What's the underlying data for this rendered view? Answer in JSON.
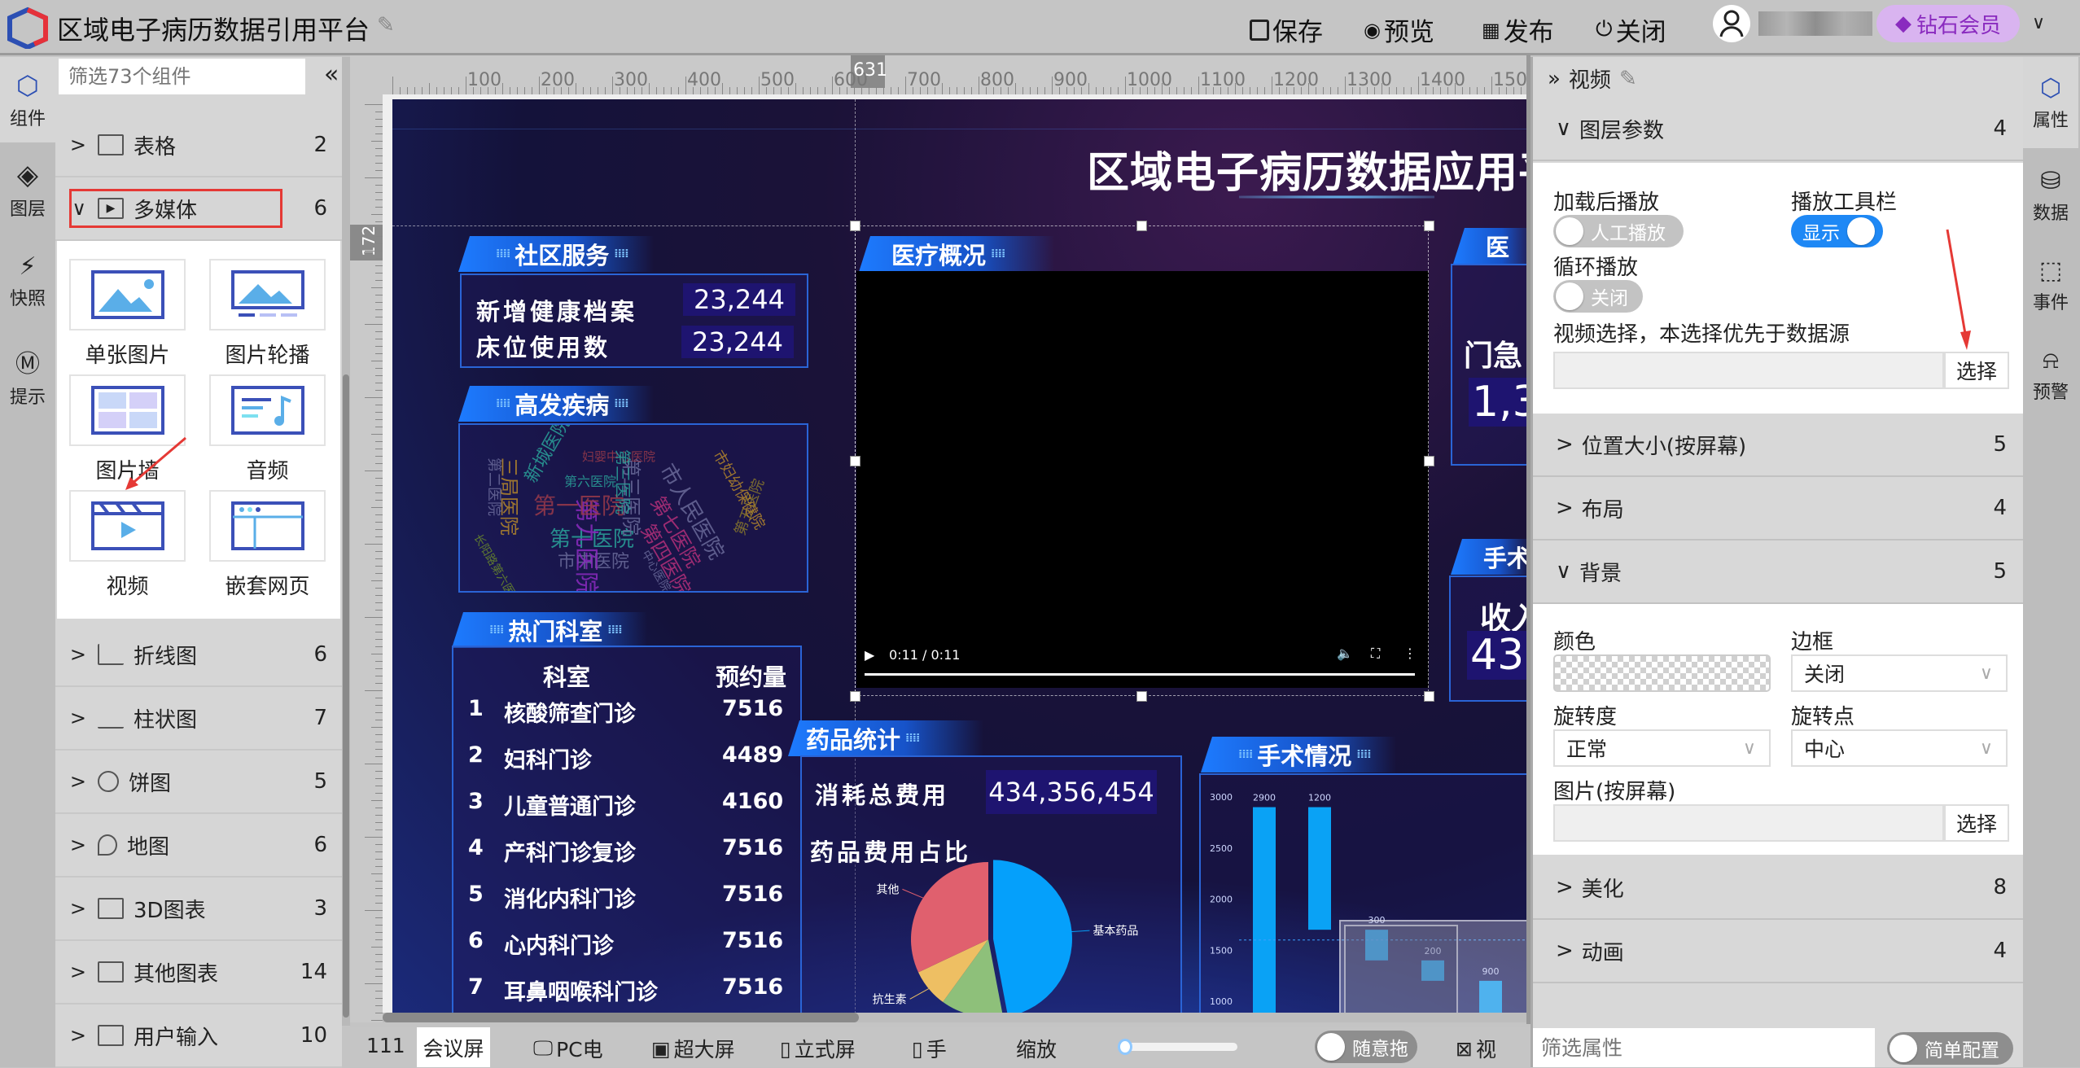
{
  "app": {
    "title": "区域电子病历数据引用平台",
    "user_name": "",
    "vip": "钻石会员"
  },
  "toolbar": {
    "save": "保存",
    "preview": "预览",
    "publish": "发布",
    "close": "关闭"
  },
  "left_rail": [
    {
      "label": "组件",
      "icon": "cube-icon"
    },
    {
      "label": "图层",
      "icon": "layers-icon"
    },
    {
      "label": "快照",
      "icon": "camera-icon"
    },
    {
      "label": "提示",
      "icon": "bulb-icon"
    }
  ],
  "components": {
    "search_placeholder": "筛选73个组件",
    "categories": [
      {
        "label": "表格",
        "count": "2",
        "expanded": false
      },
      {
        "label": "多媒体",
        "count": "6",
        "expanded": true
      },
      {
        "label": "折线图",
        "count": "6"
      },
      {
        "label": "柱状图",
        "count": "7"
      },
      {
        "label": "饼图",
        "count": "5"
      },
      {
        "label": "地图",
        "count": "6"
      },
      {
        "label": "3D图表",
        "count": "3"
      },
      {
        "label": "其他图表",
        "count": "14"
      },
      {
        "label": "用户输入",
        "count": "10"
      }
    ],
    "media_items": [
      {
        "label": "单张图片"
      },
      {
        "label": "图片轮播"
      },
      {
        "label": "图片墙"
      },
      {
        "label": "音频"
      },
      {
        "label": "视频"
      },
      {
        "label": "嵌套网页"
      }
    ]
  },
  "ruler": {
    "labels": [
      "100",
      "200",
      "300",
      "400",
      "500",
      "600",
      "700",
      "800",
      "900",
      "1000",
      "1100",
      "1200",
      "1300",
      "1400",
      "1500"
    ],
    "marker_x": "631",
    "marker_y": "172"
  },
  "dashboard": {
    "title": "区域电子病历数据应用平",
    "community": {
      "header": "社区服务",
      "rows": [
        {
          "label": "新增健康档案",
          "value": "23,244"
        },
        {
          "label": "床位使用数",
          "value": "23,244"
        }
      ]
    },
    "diseases": {
      "header": "高发疾病",
      "words": [
        "第十医院",
        "市中医院",
        "第九医院",
        "第三医院",
        "第一医院",
        "三局医院",
        "第二医院",
        "新城医院",
        "第六医院",
        "妇婴中心医院",
        "市人民医院",
        "第七医院",
        "第四医院",
        "第五医院",
        "市妇幼保健院",
        "中心医院",
        "第三医院",
        "长阳路第六医院"
      ]
    },
    "departments": {
      "header": "热门科室",
      "columns": [
        "科室",
        "预约量"
      ],
      "rows": [
        {
          "rank": "1",
          "name": "核酸筛查门诊",
          "value": "7516"
        },
        {
          "rank": "2",
          "name": "妇科门诊",
          "value": "4489"
        },
        {
          "rank": "3",
          "name": "儿童普通门诊",
          "value": "4160"
        },
        {
          "rank": "4",
          "name": "产科门诊复诊",
          "value": "7516"
        },
        {
          "rank": "5",
          "name": "消化内科门诊",
          "value": "7516"
        },
        {
          "rank": "6",
          "name": "心内科门诊",
          "value": "7516"
        },
        {
          "rank": "7",
          "name": "耳鼻咽喉科门诊",
          "value": "7516"
        }
      ]
    },
    "medical": {
      "header": "医疗概况",
      "video_time": "0:11 / 0:11"
    },
    "drugs": {
      "header": "药品统计",
      "total_label": "消耗总费用",
      "total_value": "434,356,454",
      "ratio_label": "药品费用占比",
      "pie": {
        "type": "pie",
        "slices": [
          {
            "name": "基本药品",
            "value": 47,
            "color": "#05a0fb"
          },
          {
            "name": "",
            "value": 13,
            "color": "#8ec07a"
          },
          {
            "name": "抗生素",
            "value": 8,
            "color": "#eebf63"
          },
          {
            "name": "其他",
            "value": 32,
            "color": "#e0606e"
          }
        ]
      }
    },
    "surgery": {
      "header": "手术情况",
      "chart": {
        "type": "bar",
        "yticks": [
          3000,
          2500,
          2000,
          1500,
          1000
        ],
        "ylim": [
          0,
          3000
        ],
        "values": [
          2900,
          1200,
          300,
          200,
          900
        ],
        "bases": [
          0,
          1700,
          1400,
          1200,
          300
        ],
        "color": "#0aa2f5"
      }
    },
    "right_partial": {
      "header1": "医",
      "label1": "门急",
      "value1": "1,3",
      "header2": "手术",
      "label2": "收入",
      "value2": "43"
    }
  },
  "properties": {
    "title": "视频",
    "sections": [
      {
        "label": "图层参数",
        "count": "4",
        "expanded": true
      },
      {
        "label": "位置大小(按屏幕)",
        "count": "5"
      },
      {
        "label": "布局",
        "count": "4"
      },
      {
        "label": "背景",
        "count": "5",
        "expanded": true
      },
      {
        "label": "美化",
        "count": "8"
      },
      {
        "label": "动画",
        "count": "4"
      }
    ],
    "layer": {
      "autoplay_label": "加载后播放",
      "autoplay_value": "人工播放",
      "toolbar_label": "播放工具栏",
      "toolbar_value": "显示",
      "loop_label": "循环播放",
      "loop_value": "关闭",
      "video_select_label": "视频选择，本选择优先于数据源",
      "select_btn": "选择"
    },
    "background": {
      "color_label": "颜色",
      "border_label": "边框",
      "border_value": "关闭",
      "rotate_label": "旋转度",
      "rotate_value": "正常",
      "pivot_label": "旋转点",
      "pivot_value": "中心",
      "image_label": "图片(按屏幕)",
      "select_btn": "选择"
    },
    "filter_placeholder": "筛选属性",
    "simple_config": "简单配置"
  },
  "right_rail": [
    {
      "label": "属性",
      "icon": "properties-icon"
    },
    {
      "label": "数据",
      "icon": "database-icon"
    },
    {
      "label": "事件",
      "icon": "cursor-icon"
    },
    {
      "label": "预警",
      "icon": "alarm-icon"
    }
  ],
  "bottom": {
    "page": "111",
    "screens": [
      "会议屏",
      "PC电",
      "超大屏",
      "立式屏",
      "手"
    ],
    "zoom_label": "缩放",
    "zoom_value": 0.05,
    "drag_label": "随意拖",
    "view_label": "视"
  },
  "colors": {
    "accent": "#1e88f5",
    "vip": "#8a2bbf",
    "highlight": "#e53935"
  }
}
